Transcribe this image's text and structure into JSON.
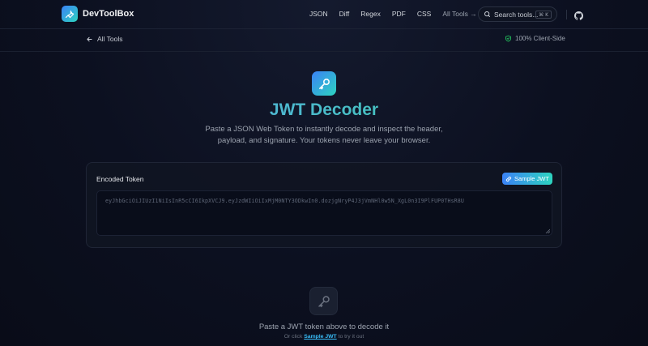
{
  "header": {
    "brand": "DevToolBox",
    "nav": [
      "JSON",
      "Diff",
      "Regex",
      "PDF",
      "CSS"
    ],
    "all_tools": "All Tools →",
    "search_placeholder": "Search tools...",
    "search_shortcut": "⌘ K"
  },
  "subbar": {
    "back_label": "All Tools",
    "client_side": "100% Client-Side"
  },
  "hero": {
    "title": "JWT Decoder",
    "subtitle": "Paste a JSON Web Token to instantly decode and inspect the header, payload, and signature. Your tokens never leave your browser."
  },
  "token_card": {
    "label": "Encoded Token",
    "sample_button": "Sample JWT",
    "placeholder": "eyJhbGciOiJIUzI1NiIsInR5cCI6IkpXVCJ9.eyJzdWIiOiIxMjM0NTY3ODkwIn0.dozjgNryP4J3jVmNHl0w5N_XgL0n3I9PlFUP0THsR8U"
  },
  "empty_state": {
    "title": "Paste a JWT token above to decode it",
    "hint_prefix": "Or click ",
    "hint_link": "Sample JWT",
    "hint_suffix": " to try it out"
  },
  "colors": {
    "accent_start": "#3b82f6",
    "accent_end": "#2dd4bf",
    "background": "#0c1020",
    "success": "#22c55e"
  }
}
